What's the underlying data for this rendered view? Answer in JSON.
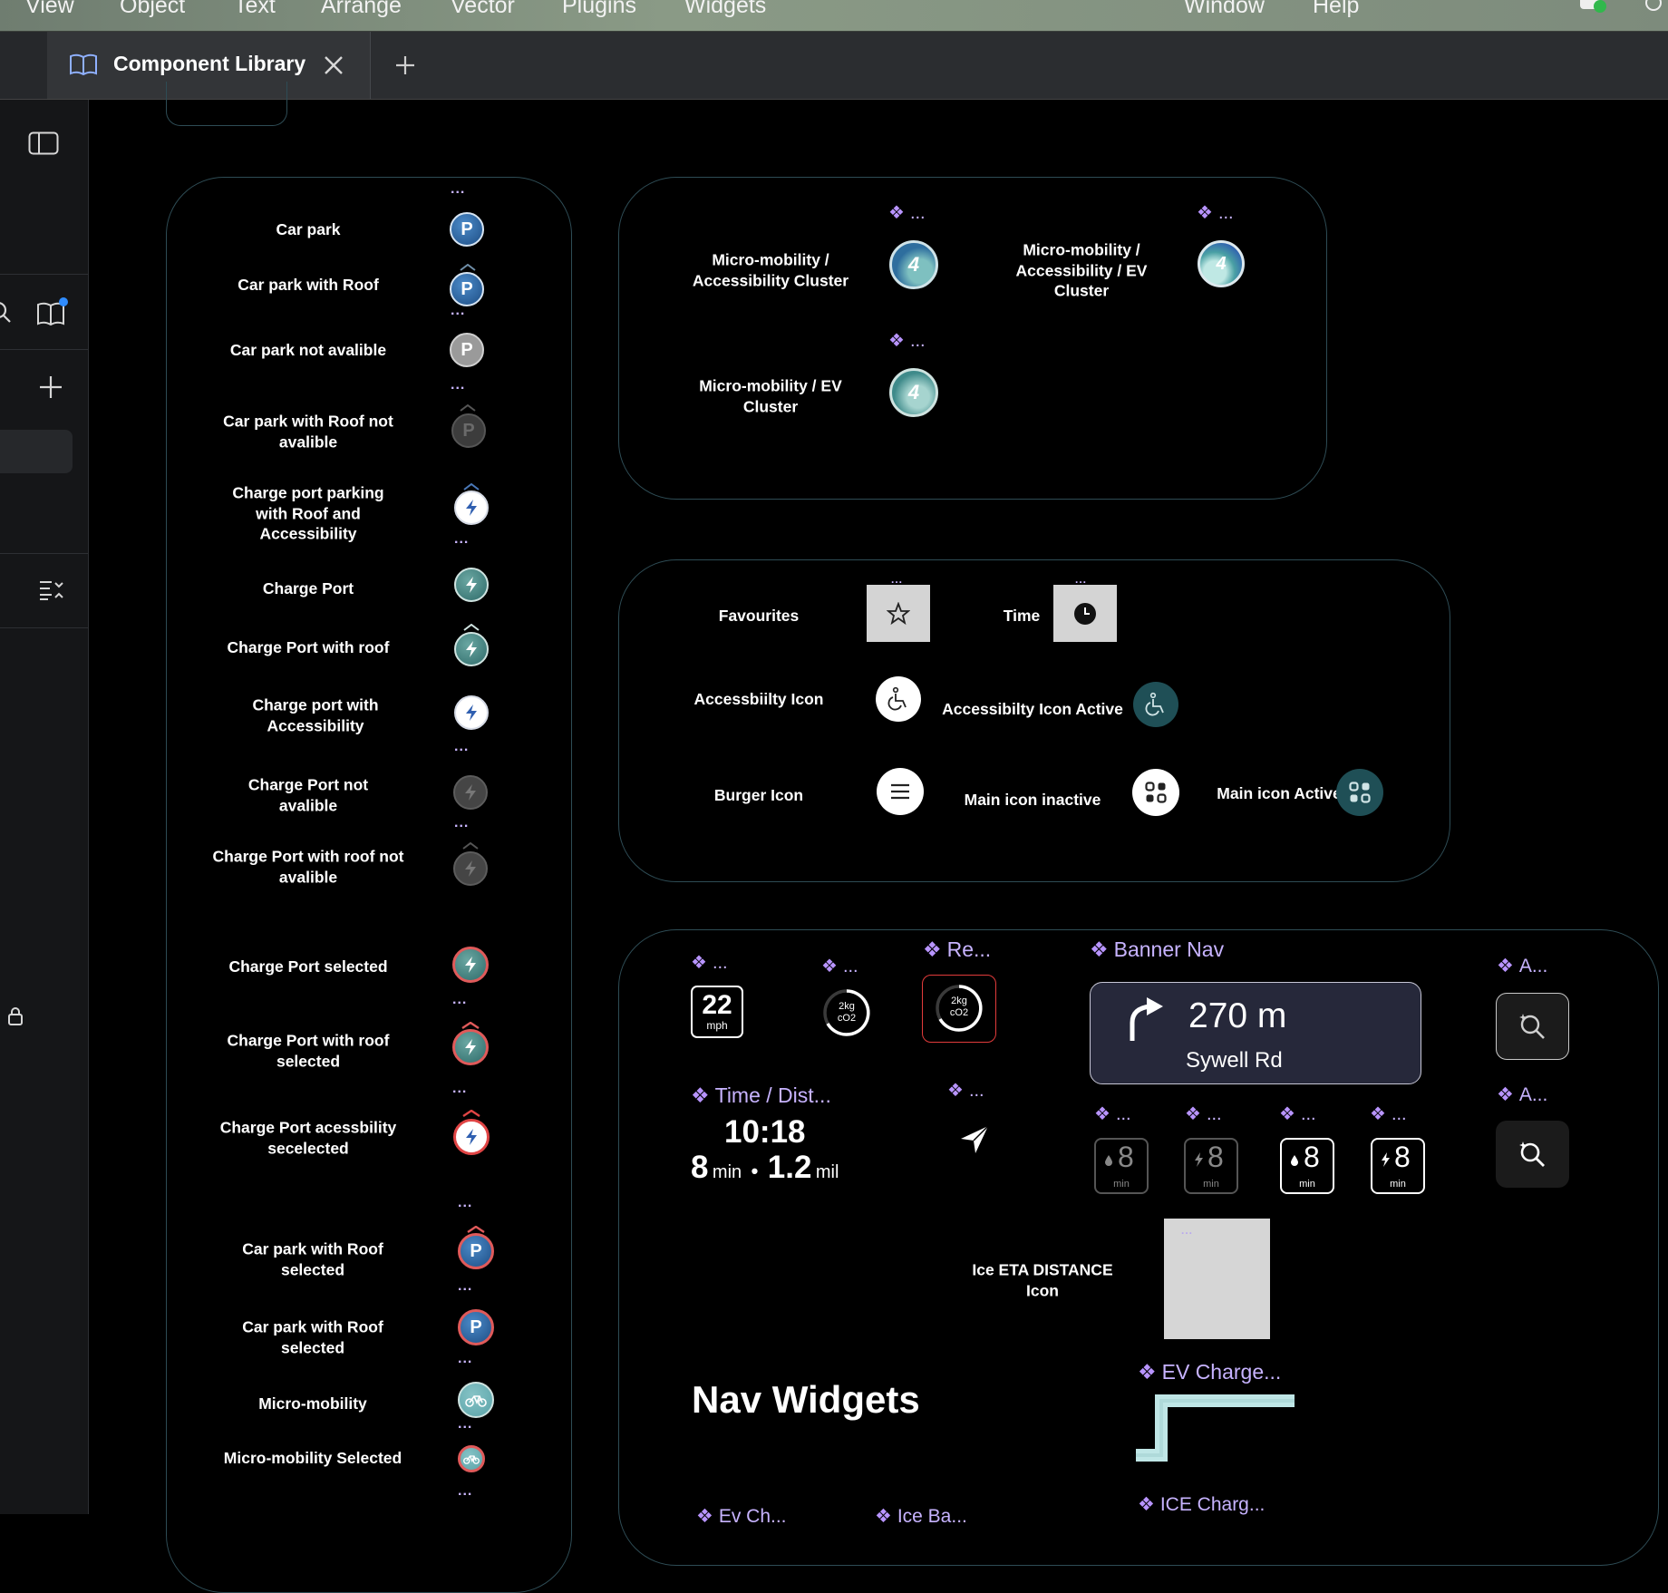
{
  "menubar": {
    "items": [
      "View",
      "Object",
      "Text",
      "Arrange",
      "Vector",
      "Plugins",
      "Widgets",
      "Window",
      "Help"
    ]
  },
  "tabs": {
    "active_label": "Component Library",
    "book_icon": "book-icon",
    "close_icon": "close-icon",
    "new_tab_icon": "plus-icon"
  },
  "rail": {
    "icons": [
      "sidebar-toggle-icon",
      "search-icon",
      "library-icon",
      "plus-icon",
      "list-collapse-icon",
      "lock-icon"
    ],
    "notification_color": "#2f8cff"
  },
  "colors": {
    "accent_purple": "#c7b3ff",
    "frame_border": "#2e4c55",
    "teal": "#2f6b6a",
    "parking_blue": "#1e4e85",
    "selected_red": "#e05a5a"
  },
  "pins_frame": {
    "overflow": "...",
    "items": [
      {
        "label": "Car park",
        "icon": "parking-pin-icon",
        "glyph": "P"
      },
      {
        "label": "Car park with Roof",
        "icon": "parking-roof-pin-icon",
        "glyph": "P"
      },
      {
        "label": "Car park not avalible",
        "icon": "parking-unavailable-pin-icon",
        "glyph": "P"
      },
      {
        "label": "Car park with Roof not avalible",
        "icon": "parking-roof-unavailable-pin-icon",
        "glyph": "P"
      },
      {
        "label": "Charge port parking with Roof and Accessibility",
        "icon": "charge-roof-accessibility-pin-icon"
      },
      {
        "label": "Charge Port",
        "icon": "charge-port-pin-icon"
      },
      {
        "label": "Charge Port with roof",
        "icon": "charge-port-roof-pin-icon"
      },
      {
        "label": "Charge port with Accessibility",
        "icon": "charge-accessibility-pin-icon"
      },
      {
        "label": "Charge Port not avalible",
        "icon": "charge-unavailable-pin-icon"
      },
      {
        "label": "Charge Port with roof not avalible",
        "icon": "charge-roof-unavailable-pin-icon"
      },
      {
        "label": "Charge Port selected",
        "icon": "charge-selected-pin-icon"
      },
      {
        "label": "Charge Port with roof selected",
        "icon": "charge-roof-selected-pin-icon"
      },
      {
        "label": "Charge Port acessbility secelected",
        "icon": "charge-accessibility-selected-pin-icon"
      },
      {
        "label": "Car park with Roof selected",
        "icon": "parking-roof-selected-pin-icon",
        "glyph": "P"
      },
      {
        "label": "Car park with Roof selected",
        "icon": "parking-selected-pin-icon",
        "glyph": "P"
      },
      {
        "label": "Micro-mobility",
        "icon": "bike-pin-icon"
      },
      {
        "label": "Micro-mobility Selected",
        "icon": "bike-selected-pin-icon"
      }
    ]
  },
  "clusters_frame": {
    "overflow": "...",
    "items": [
      {
        "label": "Micro-mobility / Accessibility Cluster",
        "count": "4",
        "icon": "cluster-accessibility-icon"
      },
      {
        "label": "Micro-mobility / Accessibility / EV Cluster",
        "count": "4",
        "icon": "cluster-accessibility-ev-icon"
      },
      {
        "label": "Micro-mobility / EV Cluster",
        "count": "4",
        "icon": "cluster-ev-icon"
      }
    ]
  },
  "icons_frame": {
    "overflow": "...",
    "items": [
      {
        "label": "Favourites",
        "icon": "star-icon"
      },
      {
        "label": "Time",
        "icon": "clock-icon"
      },
      {
        "label": "Accessbiilty Icon",
        "icon": "wheelchair-icon"
      },
      {
        "label": "Accessibilty Icon Active",
        "icon": "wheelchair-active-icon"
      },
      {
        "label": "Burger Icon",
        "icon": "burger-menu-icon"
      },
      {
        "label": "Main icon inactive",
        "icon": "main-grid-icon"
      },
      {
        "label": "Main icon Active",
        "icon": "main-grid-active-icon"
      }
    ]
  },
  "nav_widgets": {
    "heading": "Nav Widgets",
    "speed": {
      "title": "...",
      "value": "22",
      "unit": "mph"
    },
    "co2": {
      "title": "...",
      "value": "2kg",
      "unit": "cO2"
    },
    "co2_selected": {
      "title": "Re...",
      "value": "2kg",
      "unit": "cO2"
    },
    "banner": {
      "title": "Banner Nav",
      "distance": "270 m",
      "street": "Sywell Rd",
      "icon": "turn-right-arrow-icon"
    },
    "search_a": {
      "title": "A...",
      "icon": "zoom-search-icon"
    },
    "search_b": {
      "title": "A...",
      "icon": "zoom-search-icon"
    },
    "time_dist": {
      "title": "Time / Dist...",
      "time": "10:18",
      "minutes": "8",
      "min_unit": "min",
      "separator": "•",
      "distance": "1.2",
      "dist_unit": "mil"
    },
    "compass": {
      "title": "...",
      "icon": "compass-arrow-icon"
    },
    "eta_tiles": [
      {
        "title": "...",
        "value": "8",
        "unit": "min",
        "icon": "fuel-drop-icon"
      },
      {
        "title": "...",
        "value": "8",
        "unit": "min",
        "icon": "bolt-icon"
      },
      {
        "title": "...",
        "value": "8",
        "unit": "min",
        "icon": "fuel-drop-icon"
      },
      {
        "title": "...",
        "value": "8",
        "unit": "min",
        "icon": "bolt-icon"
      }
    ],
    "ice_eta": {
      "label": "Ice  ETA DISTANCE Icon",
      "overflow": "..."
    },
    "ev_charge": {
      "title": "EV Charge..."
    },
    "ice_charge": {
      "title": "ICE Charg..."
    },
    "bottom_stubs": [
      "Ev Ch...",
      "Ice Ba..."
    ]
  }
}
